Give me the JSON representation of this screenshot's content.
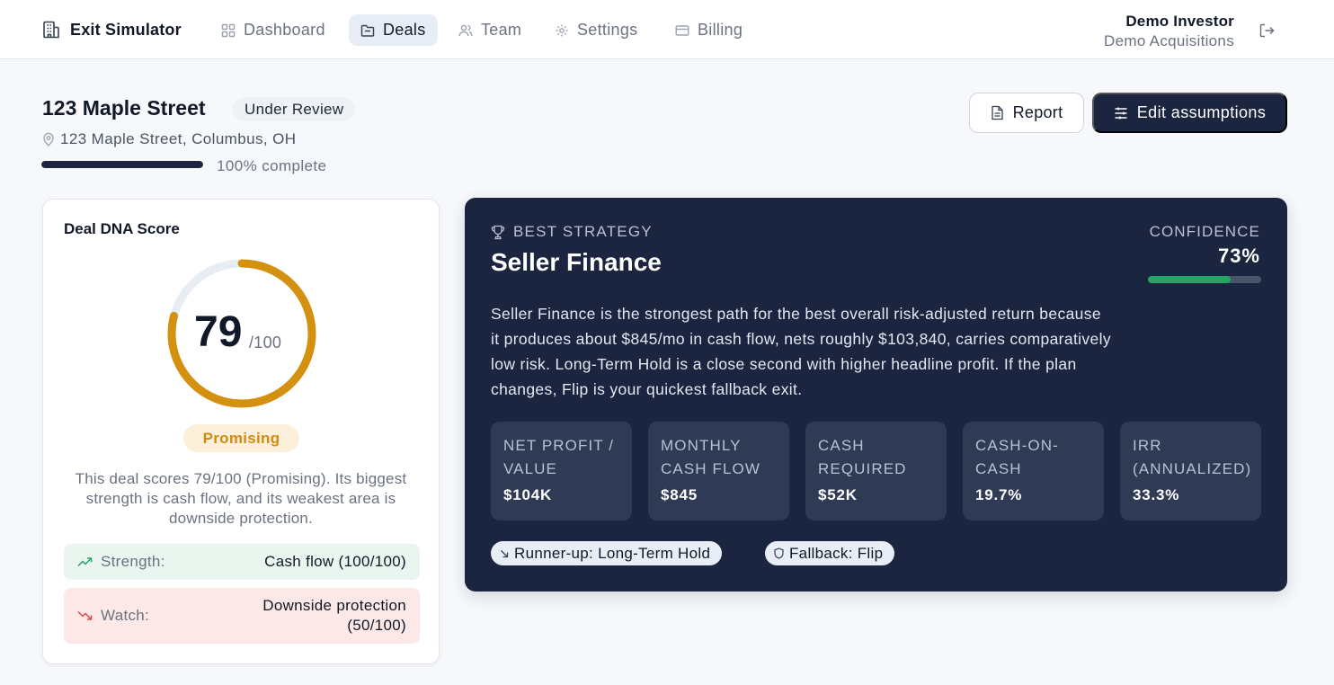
{
  "app": {
    "title": "Exit Simulator"
  },
  "nav": {
    "items": [
      {
        "label": "Dashboard",
        "icon": "dashboard-icon",
        "active": false
      },
      {
        "label": "Deals",
        "icon": "folder-icon",
        "active": true
      },
      {
        "label": "Team",
        "icon": "users-icon",
        "active": false
      },
      {
        "label": "Settings",
        "icon": "gear-icon",
        "active": false
      },
      {
        "label": "Billing",
        "icon": "credit-card-icon",
        "active": false
      }
    ]
  },
  "user": {
    "name": "Demo Investor",
    "org": "Demo Acquisitions"
  },
  "deal": {
    "title": "123 Maple Street",
    "status": "Under Review",
    "address": "123 Maple Street, Columbus, OH",
    "progress_pct": 100,
    "progress_label": "100% complete"
  },
  "actions": {
    "report_label": "Report",
    "edit_label": "Edit assumptions"
  },
  "score": {
    "title": "Deal DNA Score",
    "value": "79",
    "max": "/100",
    "fraction": 0.79,
    "verdict": "Promising",
    "summary": "This deal scores 79/100 (Promising). Its biggest strength is cash flow, and its weakest area is downside protection.",
    "strength_label": "Strength:",
    "strength_value": "Cash flow (100/100)",
    "watch_label": "Watch:",
    "watch_value": "Downside protection (50/100)",
    "colors": {
      "gauge": "#d4900f",
      "track": "#e8edf4"
    }
  },
  "strategy": {
    "eyebrow": "BEST STRATEGY",
    "name": "Seller Finance",
    "confidence_label": "CONFIDENCE",
    "confidence_value": "73%",
    "confidence_pct": 73,
    "description": "Seller Finance is the strongest path for the best overall risk-adjusted return because it produces about $845/mo in cash flow, nets roughly $103,840, carries comparatively low risk. Long-Term Hold is a close second with higher headline profit. If the plan changes, Flip is your quickest fallback exit.",
    "metrics": [
      {
        "label": "NET PROFIT / VALUE",
        "value": "$104K"
      },
      {
        "label": "MONTHLY CASH FLOW",
        "value": "$845"
      },
      {
        "label": "CASH REQUIRED",
        "value": "$52K"
      },
      {
        "label": "CASH-ON-CASH",
        "value": "19.7%"
      },
      {
        "label": "IRR (ANNUALIZED)",
        "value": "33.3%"
      }
    ],
    "runner_up": "Runner-up: Long-Term Hold",
    "fallback": "Fallback: Flip"
  }
}
